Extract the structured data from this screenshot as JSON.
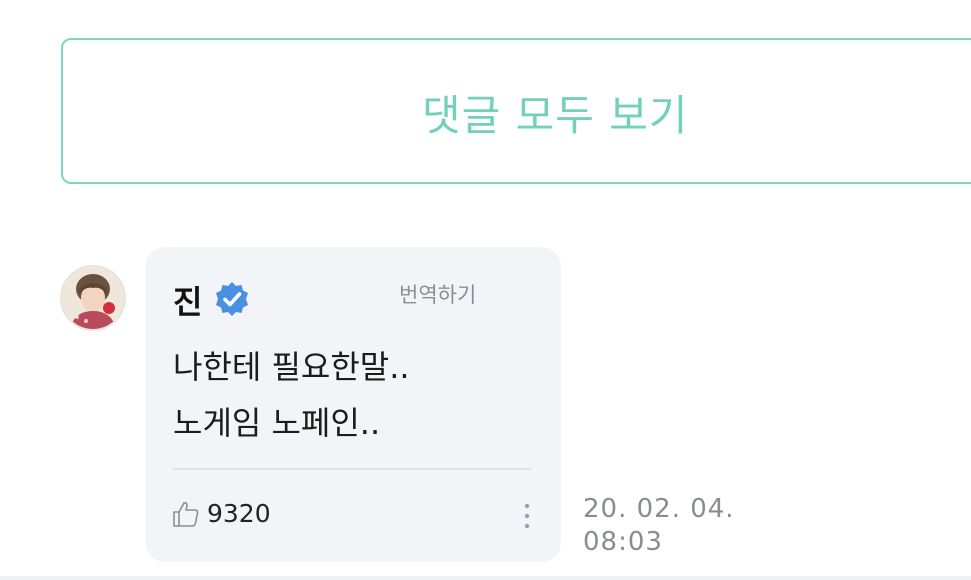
{
  "comments": {
    "view_all_label": "댓글 모두 보기"
  },
  "comment": {
    "author": "진",
    "verified_icon": "verified-badge-icon",
    "translate_label": "번역하기",
    "lines": [
      "나한테 필요한말..",
      "노게임 노페인.."
    ],
    "likes": "9320",
    "date": "20. 02. 04.",
    "time": "08:03"
  },
  "colors": {
    "accent": "#72d1b8",
    "bubble_bg": "#f3f4f8",
    "verified": "#4a90e2",
    "muted_text": "#8a8c93"
  }
}
